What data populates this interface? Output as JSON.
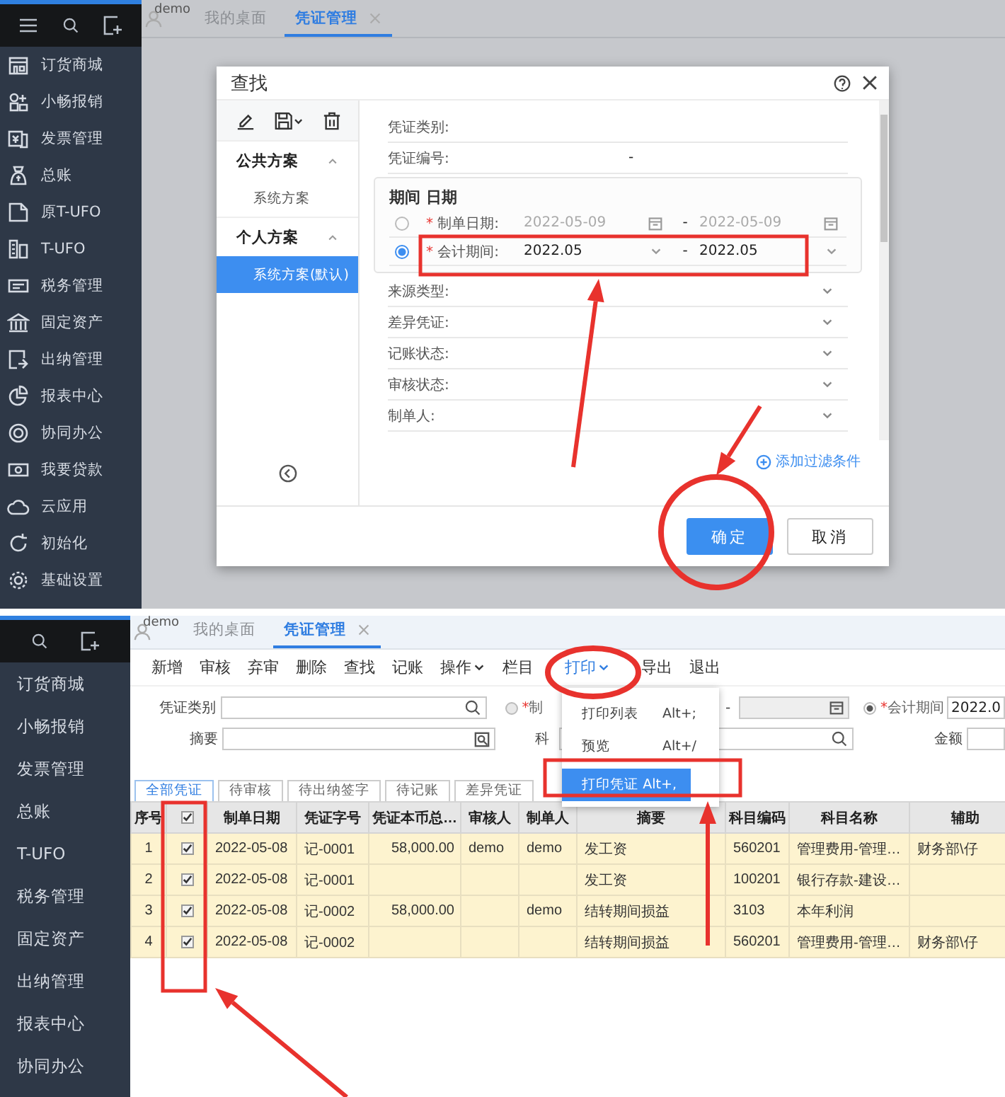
{
  "top_screen": {
    "sidebar": {
      "items": [
        "订货商城",
        "小畅报销",
        "发票管理",
        "总账",
        "原T-UFO",
        "T-UFO",
        "税务管理",
        "固定资产",
        "出纳管理",
        "报表中心",
        "协同办公",
        "我要贷款",
        "云应用",
        "初始化",
        "基础设置"
      ]
    },
    "tabs": {
      "user": "demo",
      "items": [
        {
          "label": "我的桌面",
          "selected": false,
          "closable": false
        },
        {
          "label": "凭证管理",
          "selected": true,
          "closable": true
        }
      ]
    },
    "dialog": {
      "title": "查找",
      "scheme_groups": [
        {
          "label": "公共方案",
          "expanded": true,
          "items": [
            {
              "label": "系统方案",
              "selected": false
            }
          ]
        },
        {
          "label": "个人方案",
          "expanded": true,
          "items": [
            {
              "label": "系统方案(默认)",
              "selected": true
            }
          ]
        }
      ],
      "fields": [
        {
          "kind": "text",
          "label": "凭证类别:"
        },
        {
          "kind": "range",
          "label": "凭证编号:",
          "separator": "-"
        }
      ],
      "period_group": {
        "title": "期间 日期",
        "options": [
          {
            "kind": "date",
            "required_mark": "*",
            "label": "制单日期:",
            "from": "2022-05-09",
            "separator": "-",
            "to": "2022-05-09",
            "selected": false
          },
          {
            "kind": "period",
            "required_mark": "*",
            "label": "会计期间:",
            "from": "2022.05",
            "separator": "-",
            "to": "2022.05",
            "selected": true
          }
        ]
      },
      "select_fields": [
        {
          "label": "来源类型:"
        },
        {
          "label": "差异凭证:"
        },
        {
          "label": "记账状态:"
        },
        {
          "label": "审核状态:"
        },
        {
          "label": "制单人:"
        }
      ],
      "add_filter_link": "添加过滤条件",
      "buttons": [
        {
          "label": "确定",
          "kind": "primary"
        },
        {
          "label": "取消",
          "kind": "default"
        }
      ]
    }
  },
  "bottom_screen": {
    "sidebar": {
      "items": [
        "订货商城",
        "小畅报销",
        "发票管理",
        "总账",
        "T-UFO",
        "税务管理",
        "固定资产",
        "出纳管理",
        "报表中心",
        "协同办公"
      ]
    },
    "tabs": {
      "user": "demo",
      "items": [
        {
          "label": "我的桌面",
          "selected": false,
          "closable": false
        },
        {
          "label": "凭证管理",
          "selected": true,
          "closable": true
        }
      ]
    },
    "toolbar": [
      {
        "label": "新增",
        "dropdown": false,
        "open": false
      },
      {
        "label": "审核",
        "dropdown": false,
        "open": false
      },
      {
        "label": "弃审",
        "dropdown": false,
        "open": false
      },
      {
        "label": "删除",
        "dropdown": false,
        "open": false
      },
      {
        "label": "查找",
        "dropdown": false,
        "open": false
      },
      {
        "label": "记账",
        "dropdown": false,
        "open": false
      },
      {
        "label": "操作",
        "dropdown": true,
        "open": false
      },
      {
        "label": "栏目",
        "dropdown": false,
        "open": false
      },
      {
        "label": "打印",
        "dropdown": true,
        "open": true
      },
      {
        "label": "导出",
        "dropdown": false,
        "open": false
      },
      {
        "label": "退出",
        "dropdown": false,
        "open": false
      }
    ],
    "print_menu": [
      {
        "label": "打印列表",
        "shortcut": "Alt+;",
        "selected": false
      },
      {
        "label": "预览",
        "shortcut": "Alt+/",
        "selected": false
      },
      {
        "label": "打印凭证",
        "shortcut": "Alt+,",
        "selected": true
      }
    ],
    "filters": {
      "voucher_type_label": "凭证类别",
      "summary_label": "摘要",
      "date_option": {
        "required_mark": "*",
        "label": "制",
        "selected": false
      },
      "date_separator": "-",
      "period_option": {
        "required_mark": "*",
        "label": "会计期间",
        "selected": true,
        "value": "2022.0"
      },
      "account_label": "科",
      "amount_label": "金额"
    },
    "view_tabs": [
      {
        "label": "全部凭证",
        "selected": true
      },
      {
        "label": "待审核",
        "selected": false
      },
      {
        "label": "待出纳签字",
        "selected": false
      },
      {
        "label": "待记账",
        "selected": false
      },
      {
        "label": "差异凭证",
        "selected": false
      }
    ],
    "table": {
      "columns": [
        {
          "kind": "text",
          "label": "序号"
        },
        {
          "kind": "checkbox",
          "checked": true
        },
        {
          "kind": "text",
          "label": "制单日期"
        },
        {
          "kind": "text",
          "label": "凭证字号"
        },
        {
          "kind": "text",
          "label": "凭证本币总…"
        },
        {
          "kind": "text",
          "label": "审核人"
        },
        {
          "kind": "text",
          "label": "制单人"
        },
        {
          "kind": "text",
          "label": "摘要"
        },
        {
          "kind": "text",
          "label": "科目编码"
        },
        {
          "kind": "text",
          "label": "科目名称"
        },
        {
          "kind": "text",
          "label": "辅助"
        }
      ],
      "rows": [
        {
          "cells": [
            "1",
            {
              "checked": true
            },
            "2022-05-08",
            "记-0001",
            "58,000.00",
            "demo",
            "demo",
            "发工资",
            "560201",
            "管理费用-管理…",
            "财务部\\仔"
          ]
        },
        {
          "cells": [
            "2",
            {
              "checked": true
            },
            "2022-05-08",
            "记-0001",
            null,
            null,
            null,
            "发工资",
            "100201",
            "银行存款-建设…",
            null
          ]
        },
        {
          "cells": [
            "3",
            {
              "checked": true
            },
            "2022-05-08",
            "记-0002",
            "58,000.00",
            null,
            "demo",
            "结转期间损益",
            "3103",
            "本年利润",
            null
          ]
        },
        {
          "cells": [
            "4",
            {
              "checked": true
            },
            "2022-05-08",
            "记-0002",
            null,
            null,
            null,
            "结转期间损益",
            "560201",
            "管理费用-管理…",
            "财务部\\仔"
          ]
        }
      ]
    }
  }
}
